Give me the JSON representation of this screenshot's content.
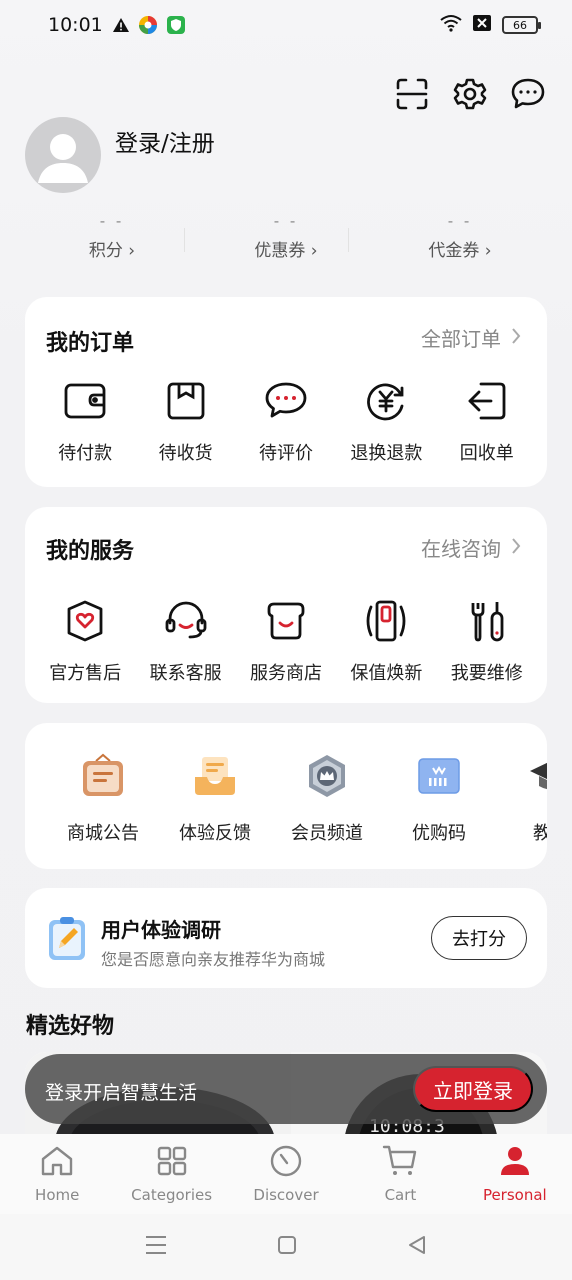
{
  "status_bar": {
    "time": "10:01",
    "battery": "66"
  },
  "header": {
    "icons": [
      "scan-icon",
      "gear-icon",
      "message-icon"
    ]
  },
  "profile": {
    "login_label": "登录/注册"
  },
  "stats": [
    {
      "value": "- -",
      "label": "积分 ›"
    },
    {
      "value": "- -",
      "label": "优惠券 ›"
    },
    {
      "value": "- -",
      "label": "代金券 ›"
    }
  ],
  "orders": {
    "title": "我的订单",
    "more": "全部订单",
    "items": [
      {
        "label": "待付款",
        "icon": "wallet-icon"
      },
      {
        "label": "待收货",
        "icon": "package-icon"
      },
      {
        "label": "待评价",
        "icon": "comment-icon"
      },
      {
        "label": "退换退款",
        "icon": "refund-icon"
      },
      {
        "label": "回收单",
        "icon": "recycle-icon"
      }
    ]
  },
  "services": {
    "title": "我的服务",
    "more": "在线咨询",
    "items": [
      {
        "label": "官方售后",
        "icon": "heart-shield-icon"
      },
      {
        "label": "联系客服",
        "icon": "headset-icon"
      },
      {
        "label": "服务商店",
        "icon": "store-icon"
      },
      {
        "label": "保值焕新",
        "icon": "phone-renew-icon"
      },
      {
        "label": "我要维修",
        "icon": "repair-tools-icon"
      }
    ]
  },
  "promos": [
    {
      "label": "商城公告",
      "icon": "bulletin-icon"
    },
    {
      "label": "体验反馈",
      "icon": "feedback-tray-icon"
    },
    {
      "label": "会员频道",
      "icon": "member-badge-icon"
    },
    {
      "label": "优购码",
      "icon": "code-card-icon"
    },
    {
      "label": "教育",
      "icon": "graduation-cap-icon"
    }
  ],
  "survey": {
    "title": "用户体验调研",
    "subtitle": "您是否愿意向亲友推荐华为商城",
    "button": "去打分"
  },
  "featured": {
    "title": "精选好物"
  },
  "login_banner": {
    "text": "登录开启智慧生活",
    "button": "立即登录"
  },
  "bottom_nav": [
    {
      "label": "Home",
      "icon": "home-icon",
      "active": false
    },
    {
      "label": "Categories",
      "icon": "grid-icon",
      "active": false
    },
    {
      "label": "Discover",
      "icon": "compass-icon",
      "active": false
    },
    {
      "label": "Cart",
      "icon": "cart-icon",
      "active": false
    },
    {
      "label": "Personal",
      "icon": "person-icon",
      "active": true
    }
  ],
  "colors": {
    "accent": "#d6232f",
    "background": "#f2f2f4"
  }
}
